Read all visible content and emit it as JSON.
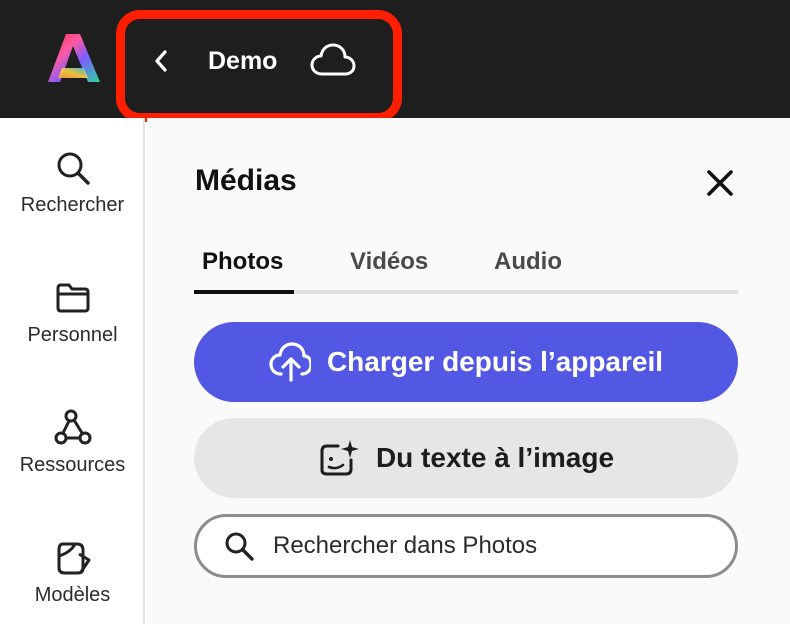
{
  "header": {
    "document_title": "Demo",
    "back_icon": "chevron-left-icon",
    "cloud_icon": "cloud-icon",
    "highlight_color": "#ff1e00"
  },
  "sidebar": {
    "items": [
      {
        "label": "Rechercher",
        "icon": "search-icon"
      },
      {
        "label": "Personnel",
        "icon": "folder-icon"
      },
      {
        "label": "Ressources",
        "icon": "shapes-icon"
      },
      {
        "label": "Modèles",
        "icon": "templates-icon"
      }
    ]
  },
  "panel": {
    "title": "Médias",
    "tabs": [
      {
        "label": "Photos",
        "active": true
      },
      {
        "label": "Vidéos",
        "active": false
      },
      {
        "label": "Audio",
        "active": false
      }
    ],
    "upload_button": "Charger depuis l’appareil",
    "text_to_image_button": "Du texte à l’image",
    "search_placeholder": "Rechercher dans Photos",
    "accent_color": "#5258e4"
  }
}
